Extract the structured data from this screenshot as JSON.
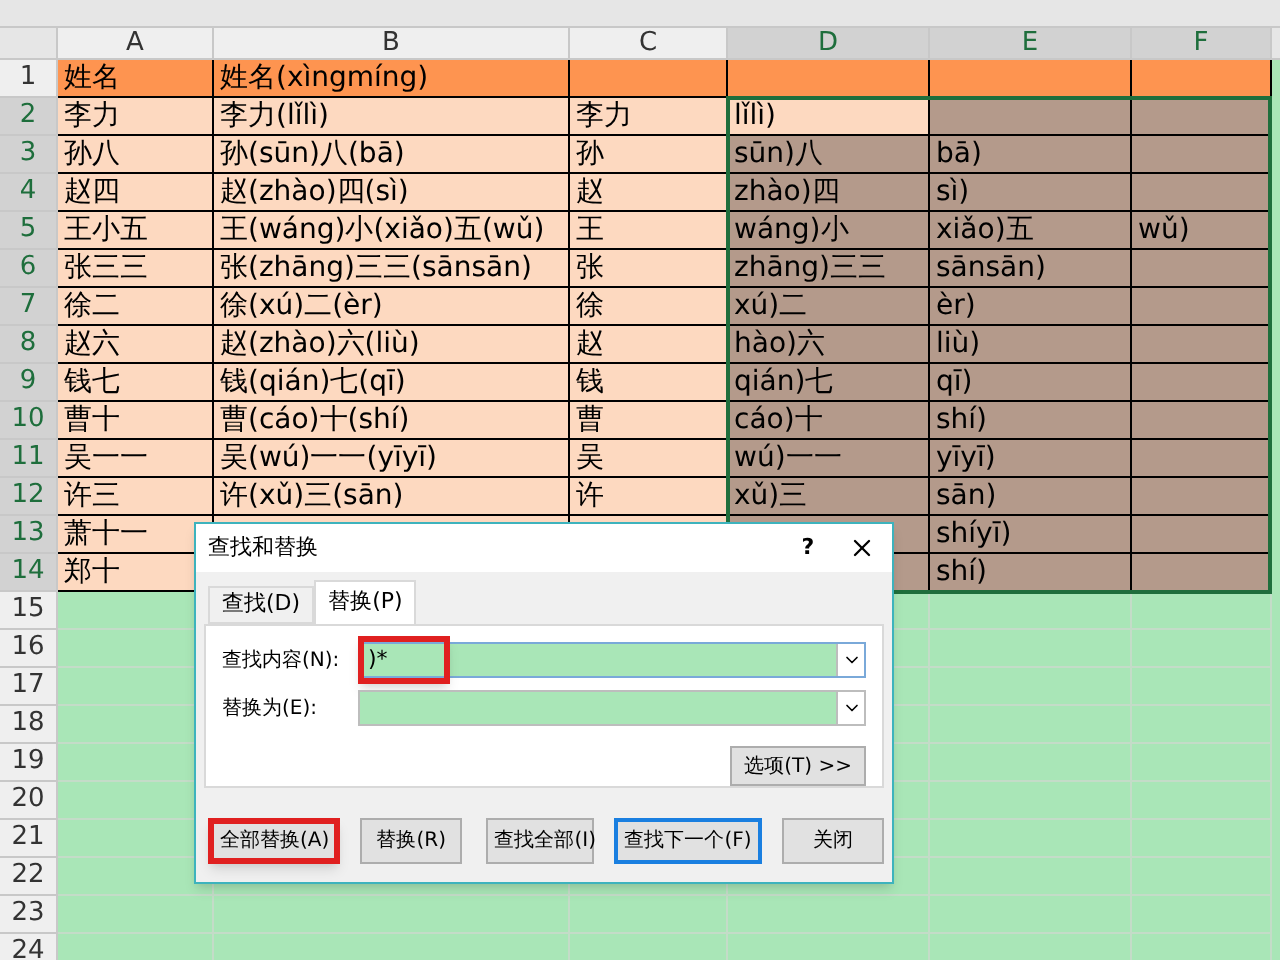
{
  "columns": [
    {
      "label": "A",
      "selected": false
    },
    {
      "label": "B",
      "selected": false
    },
    {
      "label": "C",
      "selected": false
    },
    {
      "label": "D",
      "selected": true
    },
    {
      "label": "E",
      "selected": true
    },
    {
      "label": "F",
      "selected": true
    }
  ],
  "rows": [
    {
      "number": "1",
      "kind": "header",
      "selected": false,
      "active": false,
      "cells": [
        "姓名",
        "姓名(xìngmíng)"
      ]
    },
    {
      "number": "2",
      "kind": "data",
      "selected": true,
      "active": true,
      "cells": [
        "李力",
        "李力(lǐlì)",
        "李力",
        "lǐlì)"
      ]
    },
    {
      "number": "3",
      "kind": "data",
      "selected": true,
      "active": false,
      "cells": [
        "孙八",
        "孙(sūn)八(bā)",
        "孙",
        "sūn)八",
        "bā)"
      ]
    },
    {
      "number": "4",
      "kind": "data",
      "selected": true,
      "active": false,
      "cells": [
        "赵四",
        "赵(zhào)四(sì)",
        "赵",
        "zhào)四",
        "sì)"
      ]
    },
    {
      "number": "5",
      "kind": "data",
      "selected": true,
      "active": false,
      "cells": [
        "王小五",
        "王(wáng)小(xiǎo)五(wǔ)",
        "王",
        "wáng)小",
        "xiǎo)五",
        "wǔ)"
      ]
    },
    {
      "number": "6",
      "kind": "data",
      "selected": true,
      "active": false,
      "cells": [
        "张三三",
        "张(zhāng)三三(sānsān)",
        "张",
        "zhāng)三三",
        "sānsān)"
      ]
    },
    {
      "number": "7",
      "kind": "data",
      "selected": true,
      "active": false,
      "cells": [
        "徐二",
        "徐(xú)二(èr)",
        "徐",
        "xú)二",
        "èr)"
      ]
    },
    {
      "number": "8",
      "kind": "data",
      "selected": true,
      "active": false,
      "cells": [
        "赵六",
        "赵(zhào)六(liù)",
        "赵",
        "hào)六",
        "liù)"
      ]
    },
    {
      "number": "9",
      "kind": "data",
      "selected": true,
      "active": false,
      "cells": [
        "钱七",
        "钱(qián)七(qī)",
        "钱",
        "qián)七",
        "qī)"
      ]
    },
    {
      "number": "10",
      "kind": "data",
      "selected": true,
      "active": false,
      "cells": [
        "曹十",
        "曹(cáo)十(shí)",
        "曹",
        "cáo)十",
        "shí)"
      ]
    },
    {
      "number": "11",
      "kind": "data",
      "selected": true,
      "active": false,
      "cells": [
        "吴一一",
        "吴(wú)一一(yīyī)",
        "吴",
        "wú)一一",
        "yīyī)"
      ]
    },
    {
      "number": "12",
      "kind": "data",
      "selected": true,
      "active": false,
      "cells": [
        "许三",
        "许(xǔ)三(sān)",
        "许",
        "xǔ)三",
        "sān)"
      ]
    },
    {
      "number": "13",
      "kind": "data",
      "selected": true,
      "active": false,
      "cells": [
        "萧十一",
        null,
        null,
        null,
        "shíyī)"
      ]
    },
    {
      "number": "14",
      "kind": "data",
      "selected": true,
      "active": false,
      "cells": [
        "郑十",
        null,
        null,
        null,
        "shí)"
      ]
    },
    {
      "number": "15",
      "kind": "empty",
      "selected": false,
      "active": false,
      "cells": []
    },
    {
      "number": "16",
      "kind": "empty",
      "selected": false,
      "active": false,
      "cells": []
    },
    {
      "number": "17",
      "kind": "empty",
      "selected": false,
      "active": false,
      "cells": []
    },
    {
      "number": "18",
      "kind": "empty",
      "selected": false,
      "active": false,
      "cells": []
    },
    {
      "number": "19",
      "kind": "empty",
      "selected": false,
      "active": false,
      "cells": []
    },
    {
      "number": "20",
      "kind": "empty",
      "selected": false,
      "active": false,
      "cells": []
    },
    {
      "number": "21",
      "kind": "empty",
      "selected": false,
      "active": false,
      "cells": []
    },
    {
      "number": "22",
      "kind": "empty",
      "selected": false,
      "active": false,
      "cells": []
    },
    {
      "number": "23",
      "kind": "empty",
      "selected": false,
      "active": false,
      "cells": []
    },
    {
      "number": "24",
      "kind": "empty",
      "selected": false,
      "active": false,
      "cells": []
    }
  ],
  "dialog": {
    "title": "查找和替换",
    "help": "?",
    "tabs": [
      {
        "label": "查找(D)",
        "selected": false
      },
      {
        "label": "替换(P)",
        "selected": true
      }
    ],
    "fields": [
      {
        "label": "查找内容(N):",
        "value": ")*",
        "highlighted": true
      },
      {
        "label": "替换为(E):",
        "highlighted": false
      }
    ],
    "options_button": "选项(T) >>",
    "buttons": [
      {
        "label": "全部替换(A)",
        "highlighted": true,
        "default": false
      },
      {
        "label": "替换(R)",
        "highlighted": false,
        "default": false
      },
      {
        "label": "查找全部(I)",
        "highlighted": false,
        "default": false
      },
      {
        "label": "查找下一个(F)",
        "highlighted": false,
        "default": true
      },
      {
        "label": "关闭",
        "highlighted": false,
        "default": false
      }
    ]
  }
}
